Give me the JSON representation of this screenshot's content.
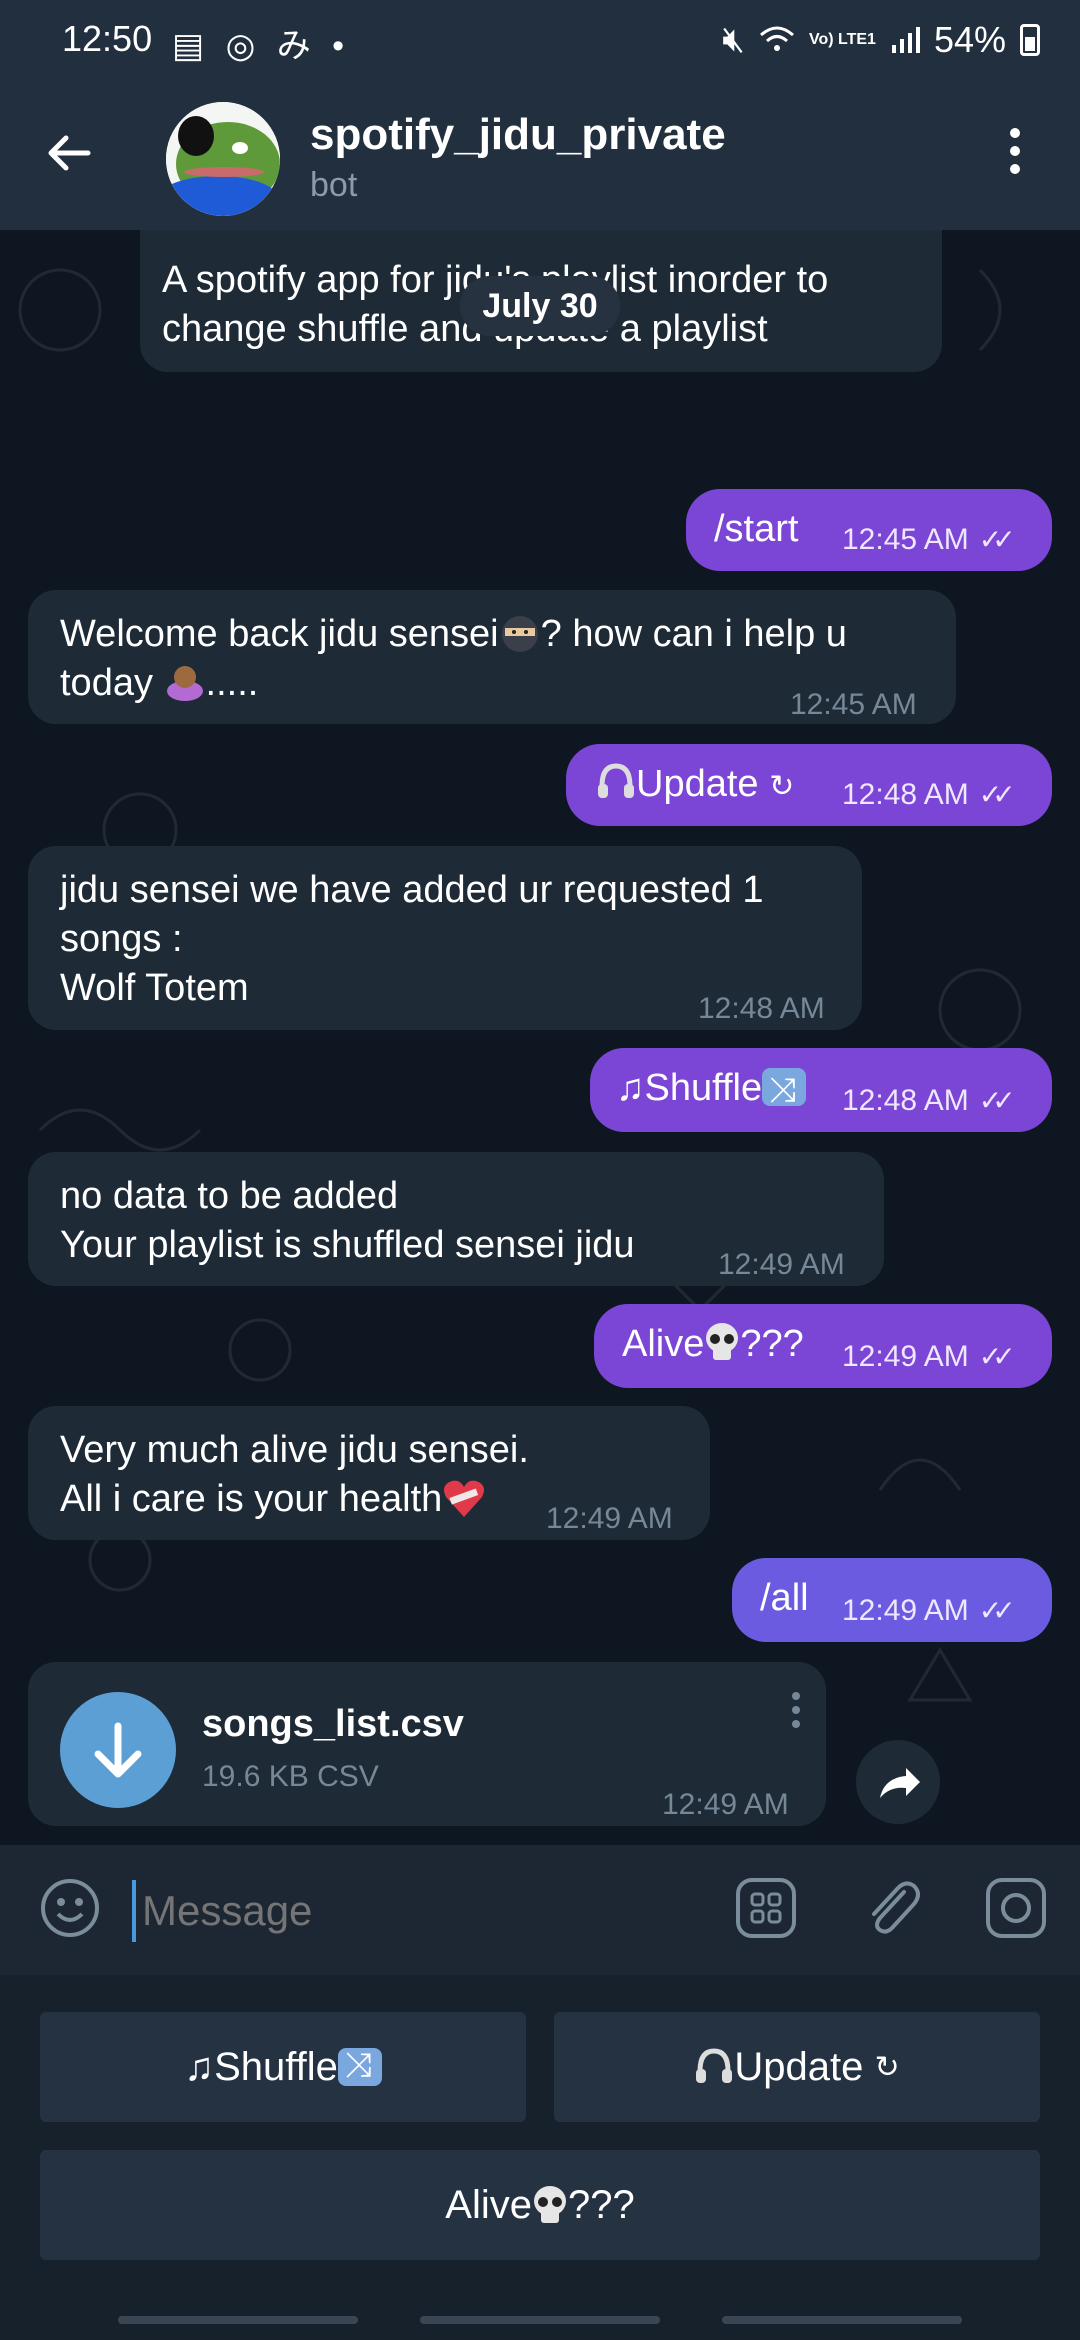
{
  "status_bar": {
    "time": "12:50",
    "battery": "54%",
    "network_label": "Vo) LTE1"
  },
  "header": {
    "title": "spotify_jidu_private",
    "subtitle": "bot"
  },
  "chat": {
    "bot_description": "A spotify app for jidu's playlist inorder to change shuffle and update a playlist",
    "date_separator": "July 30",
    "messages": [
      {
        "dir": "out",
        "text": "/start",
        "time": "12:45 AM"
      },
      {
        "dir": "in",
        "line1": "Welcome back jidu sensei",
        "line1b": "? how can i help u",
        "line2": "today",
        "line2b": ".....",
        "time": "12:45 AM"
      },
      {
        "dir": "out",
        "text": "Update",
        "suffix": "↻",
        "time": "12:48 AM"
      },
      {
        "dir": "in",
        "line1": "jidu sensei we have added ur requested 1",
        "line2": "songs :",
        "line3": "Wolf Totem",
        "time": "12:48 AM"
      },
      {
        "dir": "out",
        "prefix": "♫",
        "text": "Shuffle",
        "time": "12:48 AM"
      },
      {
        "dir": "in",
        "line1": "no data to be added",
        "line2": "Your playlist is shuffled sensei jidu",
        "time": "12:49 AM"
      },
      {
        "dir": "out",
        "text": "Alive",
        "suffix": "???",
        "time": "12:49 AM"
      },
      {
        "dir": "in",
        "line1": "Very much alive jidu sensei.",
        "line2": "All i care is your health",
        "time": "12:49 AM"
      },
      {
        "dir": "out",
        "text": "/all",
        "time": "12:49 AM"
      }
    ],
    "file": {
      "name": "songs_list.csv",
      "meta": "19.6 KB CSV",
      "time": "12:49 AM"
    }
  },
  "composer": {
    "placeholder": "Message"
  },
  "keyboard": {
    "shuffle_prefix": "♫",
    "shuffle_label": "Shuffle",
    "update_label": "Update",
    "update_suffix": "↻",
    "alive_label": "Alive",
    "alive_suffix": "???"
  },
  "colors": {
    "outgoing": "#7b45d6",
    "incoming": "#1e2a36",
    "chat_bg": "#0e1721",
    "accent": "#5b9fd5"
  }
}
